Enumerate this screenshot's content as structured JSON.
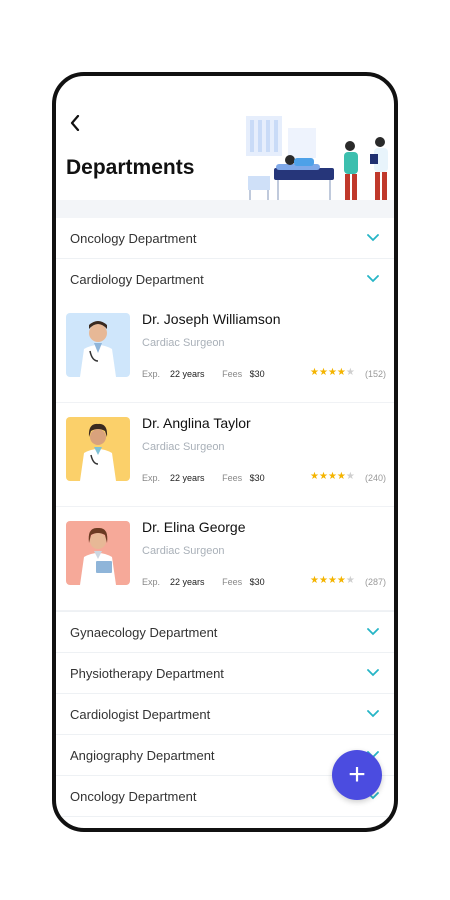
{
  "header": {
    "title": "Departments"
  },
  "departments_top": [
    {
      "label": "Oncology Department"
    },
    {
      "label": "Cardiology Department"
    }
  ],
  "doctors": [
    {
      "name": "Dr. Joseph Williamson",
      "specialty": "Cardiac Surgeon",
      "exp_label": "Exp.",
      "exp_value": "22 years",
      "fees_label": "Fees",
      "fees_value": "$30",
      "rating": 4,
      "reviews": "(152)",
      "photo_bg": "#cfe6fb"
    },
    {
      "name": "Dr. Anglina Taylor",
      "specialty": "Cardiac Surgeon",
      "exp_label": "Exp.",
      "exp_value": "22 years",
      "fees_label": "Fees",
      "fees_value": "$30",
      "rating": 4,
      "reviews": "(240)",
      "photo_bg": "#fbd06a"
    },
    {
      "name": "Dr. Elina George",
      "specialty": "Cardiac Surgeon",
      "exp_label": "Exp.",
      "exp_value": "22 years",
      "fees_label": "Fees",
      "fees_value": "$30",
      "rating": 4,
      "reviews": "(287)",
      "photo_bg": "#f6a999"
    }
  ],
  "departments_bottom": [
    {
      "label": "Gynaecology Department"
    },
    {
      "label": "Physiotherapy Department"
    },
    {
      "label": "Cardiologist Department"
    },
    {
      "label": "Angiography Department"
    },
    {
      "label": "Oncology Department"
    }
  ],
  "fab": {
    "icon": "plus-icon",
    "label": "+"
  },
  "colors": {
    "accent": "#4b4ce0",
    "chevron": "#26b5c6",
    "star": "#f4b400"
  }
}
